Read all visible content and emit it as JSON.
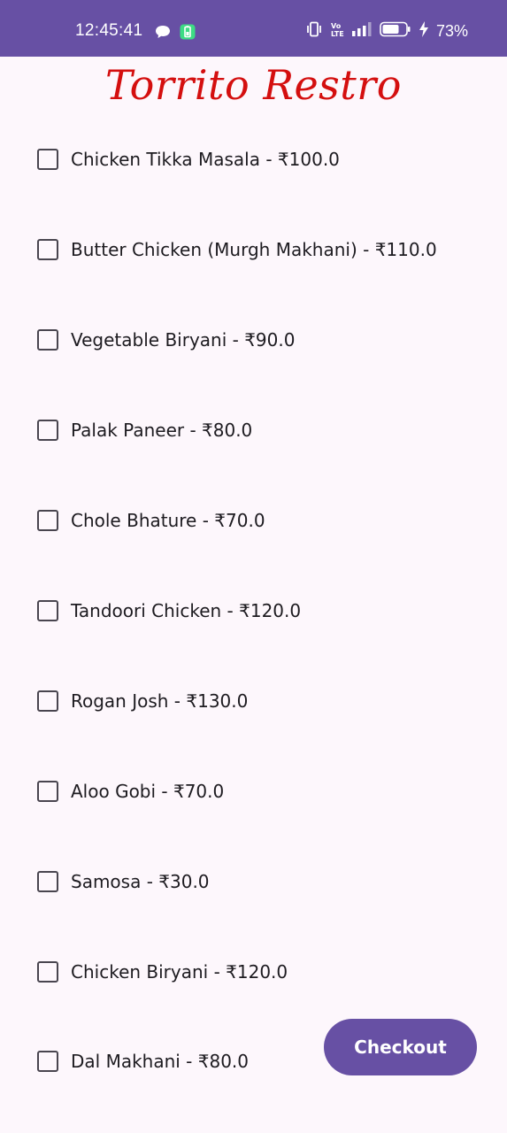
{
  "status_bar": {
    "time": "12:45:41",
    "battery_percent": "73%",
    "icons": [
      "chat-bubble-icon",
      "battery-saver-icon",
      "vibrate-icon",
      "volte-icon",
      "signal-icon",
      "battery-icon",
      "charging-icon"
    ],
    "color": "#6750a4"
  },
  "app": {
    "title": "Torrito Restro",
    "title_color": "#d40f0f"
  },
  "menu": {
    "items": [
      {
        "label": "Chicken Tikka Masala - ₹100.0",
        "checked": false
      },
      {
        "label": "Butter Chicken (Murgh Makhani) - ₹110.0",
        "checked": false
      },
      {
        "label": "Vegetable Biryani - ₹90.0",
        "checked": false
      },
      {
        "label": "Palak Paneer - ₹80.0",
        "checked": false
      },
      {
        "label": "Chole Bhature - ₹70.0",
        "checked": false
      },
      {
        "label": "Tandoori Chicken - ₹120.0",
        "checked": false
      },
      {
        "label": "Rogan Josh - ₹130.0",
        "checked": false
      },
      {
        "label": "Aloo Gobi - ₹70.0",
        "checked": false
      },
      {
        "label": "Samosa - ₹30.0",
        "checked": false
      },
      {
        "label": "Chicken Biryani - ₹120.0",
        "checked": false
      },
      {
        "label": "Dal Makhani - ₹80.0",
        "checked": false
      }
    ]
  },
  "checkout": {
    "label": "Checkout",
    "color": "#6750a4"
  }
}
